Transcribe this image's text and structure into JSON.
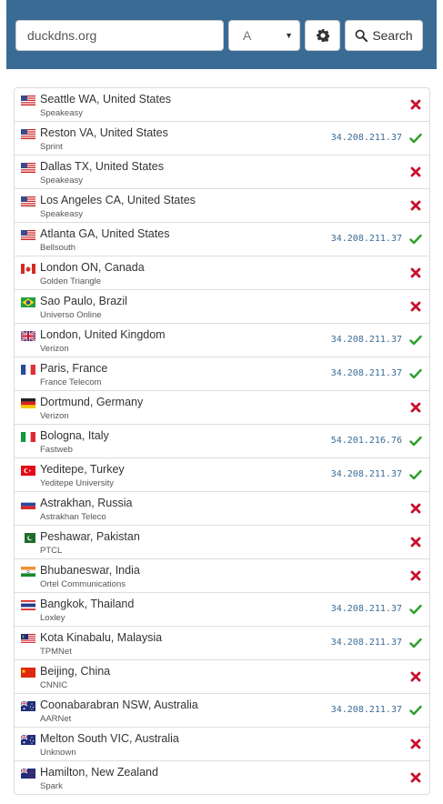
{
  "search": {
    "value": "duckdns.org",
    "record_type": "A"
  },
  "toolbar": {
    "search_label": "Search"
  },
  "colors": {
    "header": "#3a6b95",
    "ok": "#2ca02c",
    "fail": "#c8102e",
    "ip": "#3a6b95"
  },
  "results": [
    {
      "location": "Seattle WA, United States",
      "isp": "Speakeasy",
      "ip": "",
      "ok": false,
      "flag": "us"
    },
    {
      "location": "Reston VA, United States",
      "isp": "Sprint",
      "ip": "34.208.211.37",
      "ok": true,
      "flag": "us"
    },
    {
      "location": "Dallas TX, United States",
      "isp": "Speakeasy",
      "ip": "",
      "ok": false,
      "flag": "us"
    },
    {
      "location": "Los Angeles CA, United States",
      "isp": "Speakeasy",
      "ip": "",
      "ok": false,
      "flag": "us"
    },
    {
      "location": "Atlanta GA, United States",
      "isp": "Bellsouth",
      "ip": "34.208.211.37",
      "ok": true,
      "flag": "us"
    },
    {
      "location": "London ON, Canada",
      "isp": "Golden Triangle",
      "ip": "",
      "ok": false,
      "flag": "ca"
    },
    {
      "location": "Sao Paulo, Brazil",
      "isp": "Universo Online",
      "ip": "",
      "ok": false,
      "flag": "br"
    },
    {
      "location": "London, United Kingdom",
      "isp": "Verizon",
      "ip": "34.208.211.37",
      "ok": true,
      "flag": "gb"
    },
    {
      "location": "Paris, France",
      "isp": "France Telecom",
      "ip": "34.208.211.37",
      "ok": true,
      "flag": "fr"
    },
    {
      "location": "Dortmund, Germany",
      "isp": "Verizon",
      "ip": "",
      "ok": false,
      "flag": "de"
    },
    {
      "location": "Bologna, Italy",
      "isp": "Fastweb",
      "ip": "54.201.216.76",
      "ok": true,
      "flag": "it"
    },
    {
      "location": "Yeditepe, Turkey",
      "isp": "Yeditepe University",
      "ip": "34.208.211.37",
      "ok": true,
      "flag": "tr"
    },
    {
      "location": "Astrakhan, Russia",
      "isp": "Astrakhan Teleco",
      "ip": "",
      "ok": false,
      "flag": "ru"
    },
    {
      "location": "Peshawar, Pakistan",
      "isp": "PTCL",
      "ip": "",
      "ok": false,
      "flag": "pk"
    },
    {
      "location": "Bhubaneswar, India",
      "isp": "Ortel Communications",
      "ip": "",
      "ok": false,
      "flag": "in"
    },
    {
      "location": "Bangkok, Thailand",
      "isp": "Loxley",
      "ip": "34.208.211.37",
      "ok": true,
      "flag": "th"
    },
    {
      "location": "Kota Kinabalu, Malaysia",
      "isp": "TPMNet",
      "ip": "34.208.211.37",
      "ok": true,
      "flag": "my"
    },
    {
      "location": "Beijing, China",
      "isp": "CNNIC",
      "ip": "",
      "ok": false,
      "flag": "cn"
    },
    {
      "location": "Coonabarabran NSW, Australia",
      "isp": "AARNet",
      "ip": "34.208.211.37",
      "ok": true,
      "flag": "au"
    },
    {
      "location": "Melton South VIC, Australia",
      "isp": "Unknown",
      "ip": "",
      "ok": false,
      "flag": "au"
    },
    {
      "location": "Hamilton, New Zealand",
      "isp": "Spark",
      "ip": "",
      "ok": false,
      "flag": "nz"
    }
  ]
}
